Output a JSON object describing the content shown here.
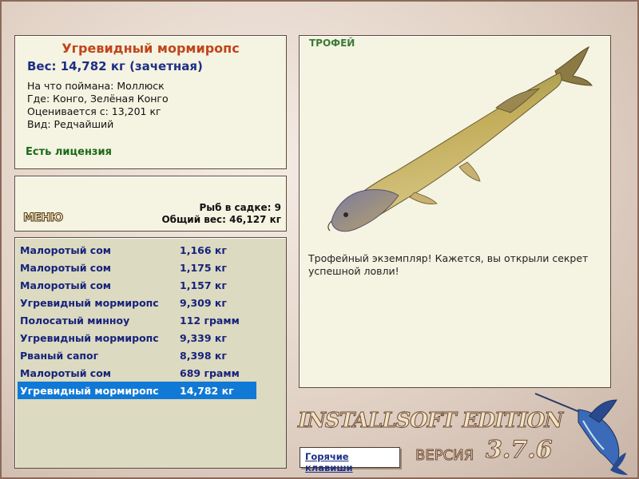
{
  "info": {
    "name": "Угревидный мормиропс",
    "weight": "Вес: 14,782 кг (зачетная)",
    "details": [
      "На что поймана: Моллюск",
      "Где: Конго, Зелёная Конго",
      "Оценивается с: 13,201 кг",
      "Вид: Редчайший"
    ],
    "license": "Есть лицензия"
  },
  "menu": {
    "label": "МЕНЮ",
    "fish_count": "Рыб в садке: 9",
    "total_weight": "Общий вес: 46,127 кг"
  },
  "catch_list": [
    {
      "name": "Малоротый сом",
      "weight": "1,166 кг"
    },
    {
      "name": "Малоротый сом",
      "weight": "1,175 кг"
    },
    {
      "name": "Малоротый сом",
      "weight": "1,157 кг"
    },
    {
      "name": "Угревидный мормиропс",
      "weight": "9,309 кг"
    },
    {
      "name": "Полосатый минноу",
      "weight": "112 грамм"
    },
    {
      "name": "Угревидный мормиропс",
      "weight": "9,339 кг"
    },
    {
      "name": "Рваный сапог",
      "weight": "8,398 кг"
    },
    {
      "name": "Малоротый сом",
      "weight": "689 грамм"
    },
    {
      "name": "Угревидный мормиропс",
      "weight": "14,782 кг"
    }
  ],
  "selected_index": 8,
  "trophy": {
    "label": "ТРОФЕЙ",
    "description": "Трофейный экземпляр! Кажется, вы открыли секрет успешной ловли!"
  },
  "branding": {
    "edition": "INSTALLSOFT EDITION",
    "version_label": "ВЕРСИЯ",
    "version_number": "3.7.6"
  },
  "hotkeys_label": "Горячие клавиши",
  "colors": {
    "panel_bg": "#f5f3e1",
    "list_bg": "#dcdac0",
    "selection": "#1079d6",
    "title_orange": "#c0451c",
    "navy_text": "#1d2f86",
    "license_green": "#1a6a17"
  },
  "icons": [
    "mormyrops-fish-image",
    "marlin-logo"
  ]
}
